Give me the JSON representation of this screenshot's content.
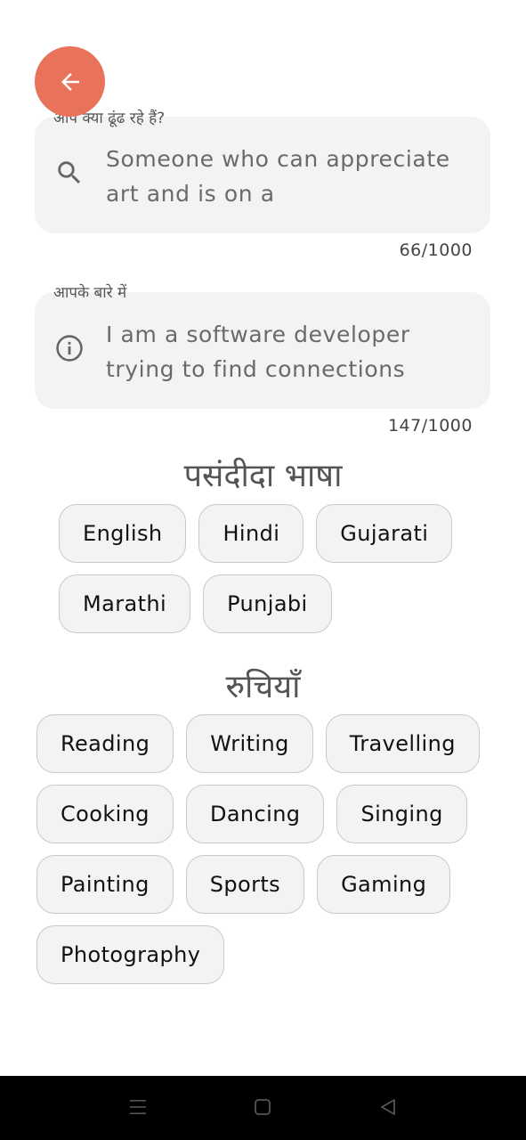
{
  "search_field": {
    "label": "आप क्या ढूंढ रहे हैं?",
    "value": "Someone who can appreciate art and is on a",
    "counter": "66/1000",
    "icon": "search-icon"
  },
  "about_field": {
    "label": "आपके बारे में",
    "value": "I am a software developer trying to find connections",
    "counter": "147/1000",
    "icon": "info-icon"
  },
  "languages": {
    "title": "पसंदीदा भाषा",
    "items": [
      "English",
      "Hindi",
      "Gujarati",
      "Marathi",
      "Punjabi"
    ]
  },
  "interests": {
    "title": "रुचियाँ",
    "items": [
      "Reading",
      "Writing",
      "Travelling",
      "Cooking",
      "Dancing",
      "Singing",
      "Painting",
      "Sports",
      "Gaming",
      "Photography"
    ]
  },
  "colors": {
    "accent": "#e8735a",
    "field_bg": "#f3f3f3",
    "chip_border": "#c9c9c9"
  }
}
